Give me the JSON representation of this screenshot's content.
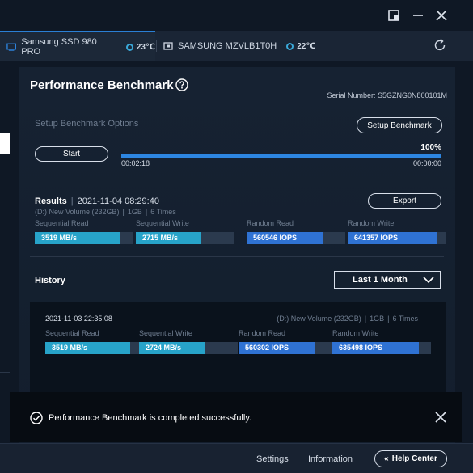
{
  "tabs": [
    {
      "label": "Samsung SSD 980 PRO",
      "temp": "23℃",
      "icon": "drive-icon"
    },
    {
      "label": "SAMSUNG MZVLB1T0H",
      "temp": "22℃",
      "icon": "drive-icon"
    }
  ],
  "page": {
    "title": "Performance Benchmark",
    "serial": "Serial Number: S5GZNG0N800101M"
  },
  "setup": {
    "label": "Setup Benchmark Options",
    "button": "Setup Benchmark",
    "start": "Start",
    "progress_percent": 100,
    "progress_text": "100%",
    "elapsed": "00:02:18",
    "remaining": "00:00:00"
  },
  "results": {
    "label": "Results",
    "datetime": "2021-11-04 08:29:40",
    "volume": "(D:) New Volume (232GB)",
    "size": "1GB",
    "times": "6 Times",
    "export": "Export",
    "metrics": [
      {
        "label": "Sequential Read",
        "value": "3519 MB/s",
        "fill": 0.86,
        "kind": "seq"
      },
      {
        "label": "Sequential Write",
        "value": "2715 MB/s",
        "fill": 0.66,
        "kind": "seq"
      },
      {
        "label": "Random Read",
        "value": "560546 IOPS",
        "fill": 0.78,
        "kind": "rnd"
      },
      {
        "label": "Random Write",
        "value": "641357 IOPS",
        "fill": 0.9,
        "kind": "rnd"
      }
    ]
  },
  "history": {
    "label": "History",
    "range": "Last 1 Month",
    "entry": {
      "datetime": "2021-11-03 22:35:08",
      "volume": "(D:) New Volume (232GB)",
      "size": "1GB",
      "times": "6 Times",
      "metrics": [
        {
          "label": "Sequential Read",
          "value": "3519 MB/s",
          "fill": 0.86,
          "kind": "seq"
        },
        {
          "label": "Sequential Write",
          "value": "2724 MB/s",
          "fill": 0.66,
          "kind": "seq"
        },
        {
          "label": "Random Read",
          "value": "560302 IOPS",
          "fill": 0.78,
          "kind": "rnd"
        },
        {
          "label": "Random Write",
          "value": "635498 IOPS",
          "fill": 0.88,
          "kind": "rnd"
        }
      ]
    }
  },
  "toast": {
    "message": "Performance Benchmark is completed successfully."
  },
  "footer": {
    "settings": "Settings",
    "information": "Information",
    "help": "Help Center"
  },
  "colors": {
    "accent": "#2d86e2",
    "sequential": "#27a3c9",
    "random": "#2f72d3",
    "background": "#0f1825"
  }
}
